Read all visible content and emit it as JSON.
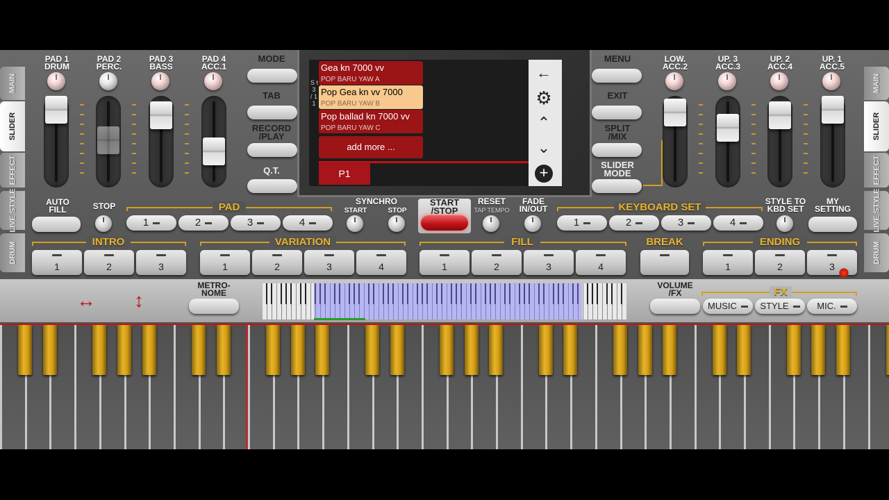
{
  "side_tabs": {
    "left": [
      "MAIN",
      "SLIDER",
      "EFFECT",
      "LIVE STYLE",
      "DRUM"
    ],
    "right": [
      "MAIN",
      "SLIDER",
      "EFFECT",
      "LIVE STYLE",
      "DRUM"
    ],
    "active": "SLIDER"
  },
  "pads_left": [
    {
      "label": "PAD 1\nDRUM",
      "slider_level": 0.85
    },
    {
      "label": "PAD 2\nPERC.",
      "slider_level": 0.55
    },
    {
      "label": "PAD 3\nBASS",
      "slider_level": 0.75
    },
    {
      "label": "PAD 4\nACC.1",
      "slider_level": 0.4
    }
  ],
  "pads_right": [
    {
      "label": "LOW.\nACC.2",
      "slider_level": 0.78
    },
    {
      "label": "UP. 3\nACC.3",
      "slider_level": 0.65
    },
    {
      "label": "UP. 2\nACC.4",
      "slider_level": 0.78
    },
    {
      "label": "UP. 1\nACC.5",
      "slider_level": 0.85
    }
  ],
  "mid_left_buttons": [
    "MODE",
    "TAB",
    "RECORD\n/PLAY",
    "Q.T."
  ],
  "mid_right_buttons": [
    "MENU",
    "EXIT",
    "SPLIT\n/MIX",
    "SLIDER\nMODE"
  ],
  "screen": {
    "side_letters": "S t y l e\n3\n/ 1\n1",
    "styles": [
      {
        "name": "Gea kn 7000 vv",
        "sub": "POP BARU YAW A",
        "selected": false
      },
      {
        "name": "Pop Gea kn vv 7000",
        "sub": "POP BARU YAW B",
        "selected": true
      },
      {
        "name": "Pop ballad kn 7000 vv",
        "sub": "POP BARU YAW C",
        "selected": false
      }
    ],
    "add_more": "add more ...",
    "page": "P1",
    "controls": [
      "back-arrow",
      "gear",
      "up",
      "down",
      "plus"
    ]
  },
  "row2": {
    "auto_fill": "AUTO\nFILL",
    "stop": "STOP",
    "pad_title": "PAD",
    "pad_buttons": [
      "1",
      "2",
      "3",
      "4"
    ],
    "synchro": "SYNCHRO",
    "synchro_start": "START",
    "synchro_stop": "STOP",
    "start_stop": "START\n/STOP",
    "reset": "RESET",
    "tap_tempo": "TAP TEMPO",
    "fade": "FADE\nIN/OUT",
    "keyboard_set": "KEYBOARD SET",
    "kbd_buttons": [
      "1",
      "2",
      "3",
      "4"
    ],
    "style_to_kbd": "STYLE TO\nKBD SET",
    "my_setting": "MY\nSETTING"
  },
  "row3": {
    "intro": {
      "title": "INTRO",
      "buttons": [
        "1",
        "2",
        "3"
      ]
    },
    "variation": {
      "title": "VARIATION",
      "buttons": [
        "1",
        "2",
        "3",
        "4"
      ]
    },
    "fill": {
      "title": "FILL",
      "buttons": [
        "1",
        "2",
        "3",
        "4"
      ]
    },
    "break": {
      "title": "BREAK"
    },
    "ending": {
      "title": "ENDING",
      "buttons": [
        "1",
        "2",
        "3"
      ]
    }
  },
  "row4": {
    "metronome": "METRO-\nNOME",
    "volume_fx": "VOLUME\n/FX",
    "fx_title": "FX",
    "fx_buttons": [
      "MUSIC",
      "STYLE",
      "MIC."
    ]
  },
  "colors": {
    "accent_gold": "#d2a020",
    "list_red": "#9b1416",
    "selected": "#f7c98e",
    "start_red": "#c0141a"
  }
}
